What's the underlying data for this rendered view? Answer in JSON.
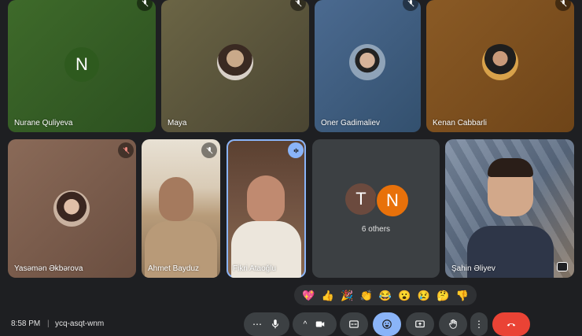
{
  "participants": [
    {
      "name": "Nurane Quliyeva",
      "initial": "N"
    },
    {
      "name": "Maya"
    },
    {
      "name": "Oner Gadimaliev"
    },
    {
      "name": "Kenan Cabbarli"
    },
    {
      "name": "Yasəmən Əkbərova"
    },
    {
      "name": "Ahmet Bayduz"
    },
    {
      "name": "Fikri Ataoğlu"
    },
    {
      "name": "Şahin Əliyev"
    }
  ],
  "others": {
    "label": "6 others",
    "initials": [
      "T",
      "N"
    ]
  },
  "reactions": [
    "💖",
    "👍",
    "🎉",
    "👏",
    "😂",
    "😮",
    "😢",
    "🤔",
    "👎"
  ],
  "meeting": {
    "time": "8:58 PM",
    "code": "ycq-asqt-wnm"
  },
  "colors": {
    "accent": "#8ab4f8",
    "end_call": "#ea4335",
    "tile_bg": "#3c4043",
    "emoji_active": "#8ab4f8"
  }
}
